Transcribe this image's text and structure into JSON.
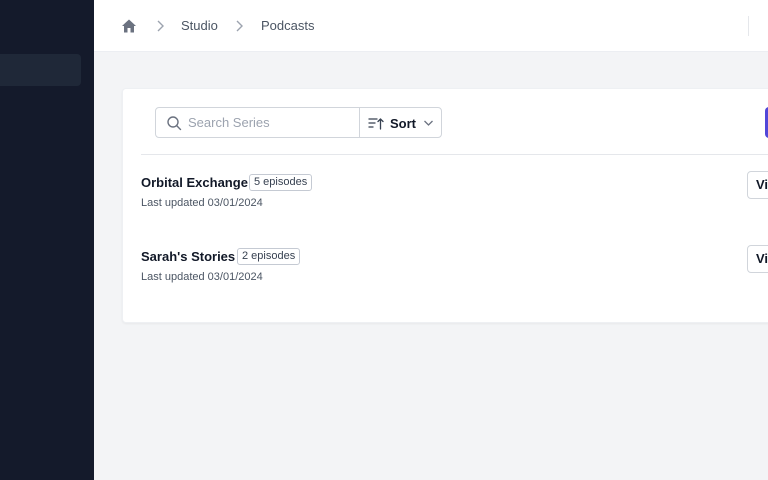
{
  "breadcrumb": {
    "home_icon": "home-icon",
    "items": [
      "Studio",
      "Podcasts"
    ]
  },
  "toolbar": {
    "search_placeholder": "Search Series",
    "sort_label": "Sort"
  },
  "series": [
    {
      "title": "Orbital Exchange",
      "episodes": "5 episodes",
      "updated": "Last updated 03/01/2024",
      "action": "View"
    },
    {
      "title": "Sarah's Stories",
      "episodes": "2 episodes",
      "updated": "Last updated 03/01/2024",
      "action": "View"
    }
  ],
  "colors": {
    "sidebar": "#141a2b",
    "primary": "#5146d8"
  }
}
